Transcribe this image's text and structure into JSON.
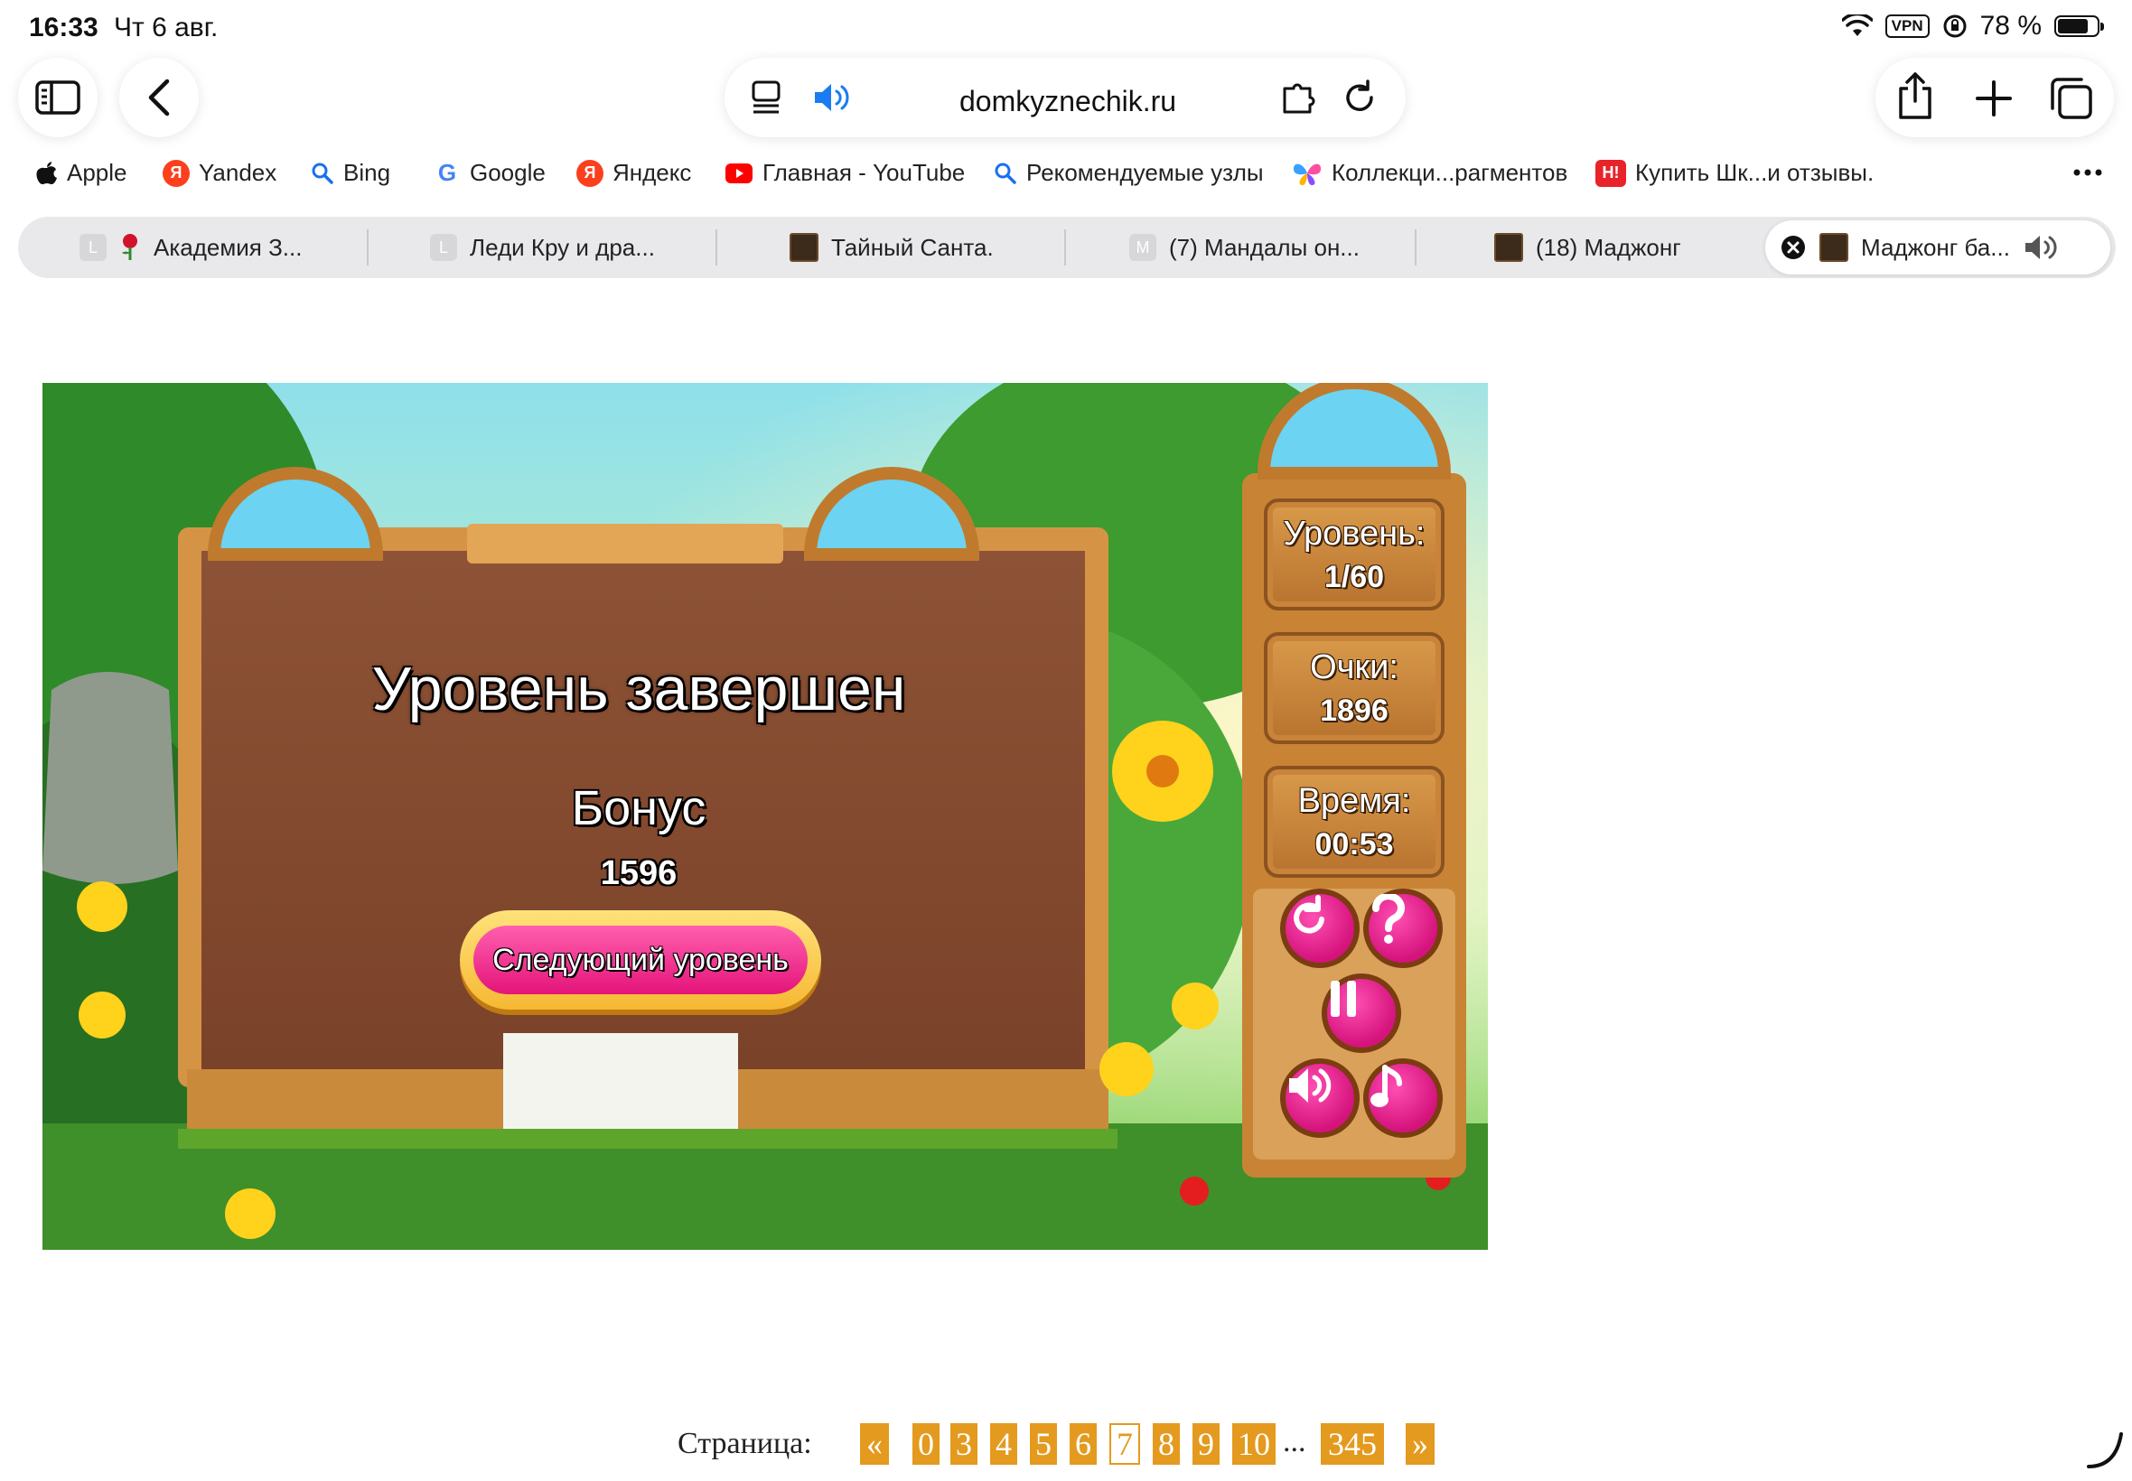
{
  "status_bar": {
    "time": "16:33",
    "date": "Чт 6 авг.",
    "vpn": "VPN",
    "battery": "78 %",
    "battery_fraction": 0.78
  },
  "address_bar": {
    "url": "domkyznechik.ru"
  },
  "favorites": [
    {
      "label": "Apple",
      "icon": "apple-icon"
    },
    {
      "label": "Yandex",
      "icon": "yandex-icon"
    },
    {
      "label": "Bing",
      "icon": "search-icon"
    },
    {
      "label": "Google",
      "icon": "google-icon"
    },
    {
      "label": "Яндекс",
      "icon": "yandex-icon"
    },
    {
      "label": "Главная - YouTube",
      "icon": "youtube-icon"
    },
    {
      "label": "Рекомендуемые узлы",
      "icon": "search-icon"
    },
    {
      "label": "Коллекци...рагментов",
      "icon": "butterfly-icon"
    },
    {
      "label": "Купить Шк...и отзывы.",
      "icon": "store-icon"
    }
  ],
  "tabs": [
    {
      "label": "Академия З...",
      "letter": "L"
    },
    {
      "label": "Леди Кру и дра...",
      "letter": "L"
    },
    {
      "label": "Тайный Санта.",
      "letter": ""
    },
    {
      "label": "(7) Мандалы он...",
      "letter": "M"
    },
    {
      "label": "(18) Маджонг",
      "letter": ""
    },
    {
      "label": "Маджонг ба...",
      "letter": ""
    }
  ],
  "game": {
    "title": "Уровень завершен",
    "bonus_label": "Бонус",
    "bonus_value": "1596",
    "next_button": "Следующий уровень",
    "level_label": "Уровень:",
    "level_value": "1/60",
    "score_label": "Очки:",
    "score_value": "1896",
    "time_label": "Время:",
    "time_value": "00:53"
  },
  "pagination": {
    "label": "Страница:",
    "prev": "«",
    "pages": [
      "0",
      "3",
      "4",
      "5",
      "6",
      "7",
      "8",
      "9",
      "10"
    ],
    "current": "7",
    "ellipsis": "...",
    "last": "345",
    "next": "»"
  },
  "colors": {
    "accent": "#e49a1e",
    "game_pink": "#e4147a",
    "wood": "#b8732e"
  }
}
